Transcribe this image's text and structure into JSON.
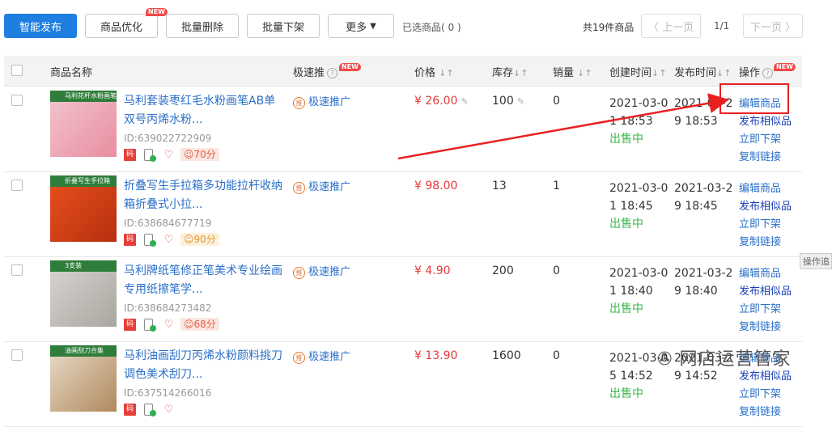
{
  "toolbar": {
    "smart_publish": "智能发布",
    "optimize": "商品优化",
    "new_badge": "NEW",
    "batch_delete": "批量删除",
    "batch_offline": "批量下架",
    "more": "更多",
    "selected": "已选商品( 0 )",
    "total": "共19件商品",
    "prev": "上一页",
    "page": "1/1",
    "next": "下一页"
  },
  "header": {
    "name": "商品名称",
    "promo": "极速推",
    "price": "价格",
    "stock": "库存",
    "sales": "销量",
    "created": "创建时间",
    "published": "发布时间",
    "ops": "操作"
  },
  "products": [
    {
      "title": "马利套装枣红毛水粉画笔AB单双号丙烯水粉...",
      "thumb_text": "马利花杆水粉画笔",
      "id": "ID:639022722909",
      "ma": "码",
      "score": "70分",
      "promo": "极速推广",
      "price": "¥ 26.00",
      "stock": "100",
      "sales": "0",
      "created": "2021-03-01 18:53",
      "status": "出售中",
      "published": "2021-03-29 18:53",
      "ops": [
        "编辑商品",
        "发布相似品",
        "立即下架",
        "复制链接"
      ]
    },
    {
      "title": "折叠写生手拉箱多功能拉杆收纳箱折叠式小拉...",
      "thumb_text": "折叠写生手拉箱",
      "id": "ID:638684677719",
      "ma": "码",
      "score": "90分",
      "promo": "极速推广",
      "price": "¥ 98.00",
      "stock": "13",
      "sales": "1",
      "created": "2021-03-01 18:45",
      "status": "出售中",
      "published": "2021-03-29 18:45",
      "ops": [
        "编辑商品",
        "发布相似品",
        "立即下架",
        "复制链接"
      ]
    },
    {
      "title": "马利牌纸笔修正笔美术专业绘画专用纸擦笔学...",
      "thumb_text": "3支装",
      "id": "ID:638684273482",
      "ma": "码",
      "score": "68分",
      "promo": "极速推广",
      "price": "¥ 4.90",
      "stock": "200",
      "sales": "0",
      "created": "2021-03-01 18:40",
      "status": "出售中",
      "published": "2021-03-29 18:40",
      "ops": [
        "编辑商品",
        "发布相似品",
        "立即下架",
        "复制链接"
      ]
    },
    {
      "title": "马利油画刮刀丙烯水粉颜料挑刀调色美术刮刀...",
      "thumb_text": "油画刮刀合集",
      "id": "ID:637514266016",
      "ma": "码",
      "score": "",
      "promo": "极速推广",
      "price": "¥ 13.90",
      "stock": "1600",
      "sales": "0",
      "created": "2021-03-05 14:52",
      "status": "出售中",
      "published": "2021-03-29 14:52",
      "ops": [
        "编辑商品",
        "发布相似品",
        "立即下架",
        "复制链接"
      ]
    }
  ],
  "side_button": "操作追",
  "watermark": "网店运营管家",
  "colors": {
    "primary": "#1f7fe0",
    "link": "#2a6fc9",
    "price": "#e4393c",
    "status": "#3cb54a",
    "annotation": "#e82020"
  }
}
